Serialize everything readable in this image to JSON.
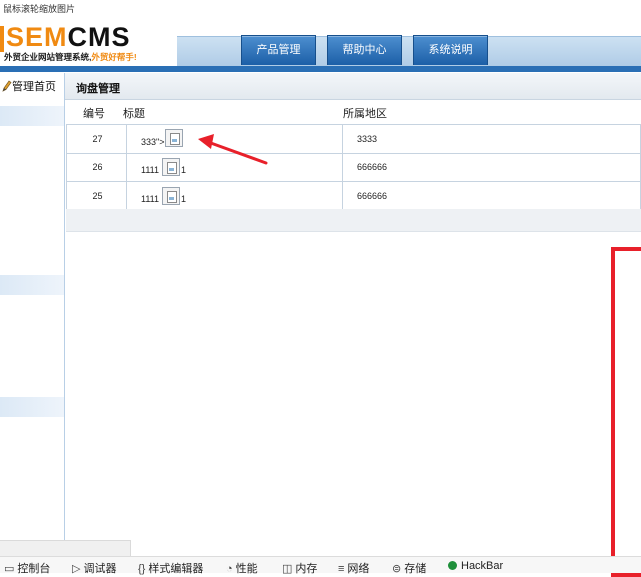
{
  "caption": "鼠标滚轮缩放图片",
  "logo": {
    "sem": "SEM",
    "cms": "CMS",
    "tagline": "外贸企业网站管理系统,",
    "tagline_highlight": "外贸好帮手!"
  },
  "nav": {
    "tabs": [
      {
        "label": "产品管理"
      },
      {
        "label": "帮助中心"
      },
      {
        "label": "系统说明"
      }
    ]
  },
  "sidebar": {
    "home_label": "管理首页"
  },
  "main": {
    "title": "询盘管理",
    "columns": {
      "id": "编号",
      "title": "标题",
      "region": "所属地区"
    },
    "rows": [
      {
        "id": "27",
        "title": "333\">",
        "title_suffix": "",
        "region": "3333"
      },
      {
        "id": "26",
        "title": "1111",
        "title_suffix": "1",
        "region": "666666"
      },
      {
        "id": "25",
        "title": "1111",
        "title_suffix": "1",
        "region": "666666"
      }
    ]
  },
  "devtools": {
    "items": [
      {
        "icon": "console-icon",
        "label": "控制台"
      },
      {
        "icon": "debugger-icon",
        "label": "调试器"
      },
      {
        "icon": "style-editor-icon",
        "label": "样式编辑器"
      },
      {
        "icon": "performance-icon",
        "label": "性能"
      },
      {
        "icon": "memory-icon",
        "label": "内存"
      },
      {
        "icon": "network-icon",
        "label": "网络"
      },
      {
        "icon": "storage-icon",
        "label": "存储"
      },
      {
        "icon": "hackbar-icon",
        "label": "HackBar"
      }
    ]
  },
  "colors": {
    "brand_orange": "#f08a12",
    "nav_blue": "#2a6fb5",
    "annotation_red": "#e8202a"
  }
}
